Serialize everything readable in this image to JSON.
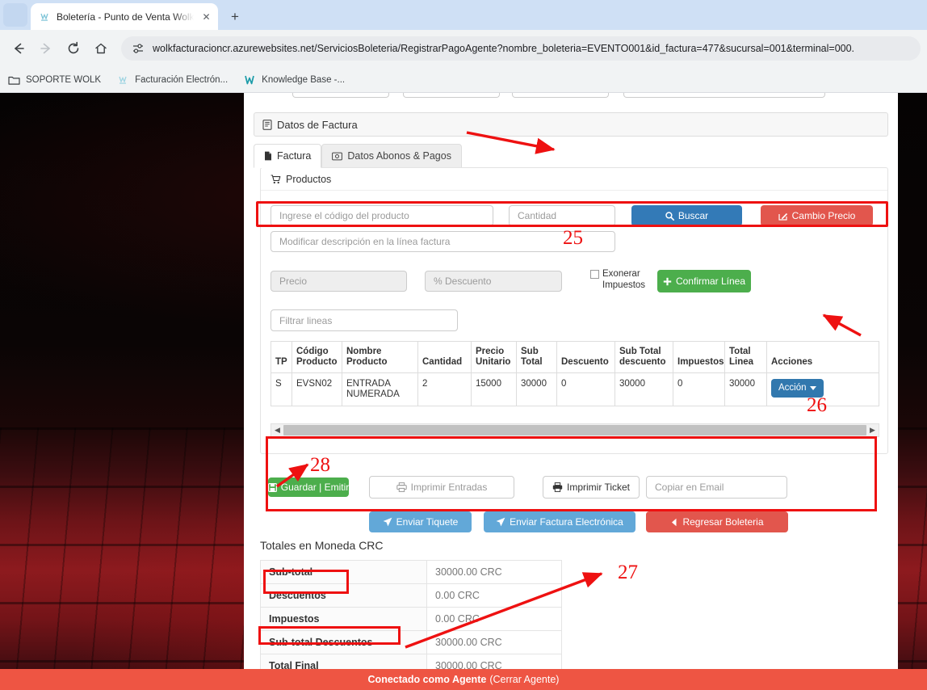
{
  "browser": {
    "tab": {
      "title": "Boletería - Punto de Venta Wolk",
      "favicon": "wolk-favicon",
      "close": "✕"
    },
    "new_tab_label": "+",
    "tab_list_chevron": "⌄",
    "nav": {
      "back": "←",
      "forward": "→",
      "reload": "⟳",
      "home": "⌂"
    },
    "omnibox": {
      "site_icon": "site-settings-icon",
      "url": "wolkfacturacioncr.azurewebsites.net/ServiciosBoleteria/RegistrarPagoAgente?nombre_boleteria=EVENTO001&id_factura=477&sucursal=001&terminal=000."
    },
    "bookmarks": [
      {
        "label": "SOPORTE WOLK",
        "icon": "folder-icon"
      },
      {
        "label": "Facturación Electrón...",
        "icon": "wolk-favicon"
      },
      {
        "label": "Knowledge Base -...",
        "icon": "w-logo-icon"
      }
    ]
  },
  "page": {
    "section_header": {
      "icon": "invoice-icon",
      "title": "Datos de Factura"
    },
    "tabs": [
      {
        "label": "Factura",
        "icon": "file-icon",
        "active": true
      },
      {
        "label": "Datos Abonos & Pagos",
        "icon": "money-icon",
        "active": false
      }
    ],
    "panel": {
      "icon": "cart-icon",
      "title": "Productos"
    },
    "form": {
      "codigo_placeholder": "Ingrese el código del producto",
      "cantidad_placeholder": "Cantidad",
      "descripcion_placeholder": "Modificar descripción en la línea factura",
      "precio_placeholder": "Precio",
      "descuento_placeholder": "% Descuento",
      "filtrar_placeholder": "Filtrar lineas",
      "buscar_label": "Buscar",
      "cambio_precio_label": "Cambio Precio",
      "exonerar_label": "Exonerar Impuestos",
      "confirmar_label": "Confirmar Línea"
    },
    "lines_table": {
      "headers": [
        "TP",
        "Código Producto",
        "Nombre Producto",
        "Cantidad",
        "Precio Unitario",
        "Sub Total",
        "Descuento",
        "Sub Total descuento",
        "Impuestos",
        "Total Linea",
        "Acciones"
      ],
      "rows": [
        {
          "tp": "S",
          "codigo": "EVSN02",
          "nombre": "ENTRADA NUMERADA",
          "cantidad": "2",
          "precio_unitario": "15000",
          "sub_total": "30000",
          "descuento": "0",
          "sub_total_descuento": "30000",
          "impuestos": "0",
          "total_linea": "30000",
          "accion_label": "Acción"
        }
      ]
    },
    "buttons": {
      "guardar_emitir": "Guardar | Emitir",
      "imprimir_entradas": "Imprimir Entradas",
      "imprimir_ticket": "Imprimir Ticket",
      "copiar_email_placeholder": "Copiar en Email",
      "enviar_tiquete": "Enviar Tiquete",
      "enviar_factura_electronica": "Enviar Factura Electrónica",
      "regresar_boleteria": "Regresar Boleteria"
    },
    "totals": {
      "title": "Totales en Moneda CRC",
      "rows": [
        {
          "label": "Sub-total",
          "value": "30000.00 CRC"
        },
        {
          "label": "Descuentos",
          "value": "0.00 CRC"
        },
        {
          "label": "Impuestos",
          "value": "0.00 CRC"
        },
        {
          "label": "Sub-total Descuentos",
          "value": "30000.00 CRC"
        },
        {
          "label": "Total Final",
          "value": "30000.00 CRC"
        }
      ]
    },
    "footer": {
      "status": "Conectado como Agente",
      "link": "(Cerrar Agente)"
    }
  },
  "annotations": {
    "color": "#ee1111",
    "items": [
      {
        "number": "25",
        "target": "datos-de-factura-header"
      },
      {
        "number": "26",
        "target": "lines-table"
      },
      {
        "number": "27",
        "target": "totales-title"
      },
      {
        "number": "28",
        "target": "guardar-emitir-button"
      }
    ]
  }
}
